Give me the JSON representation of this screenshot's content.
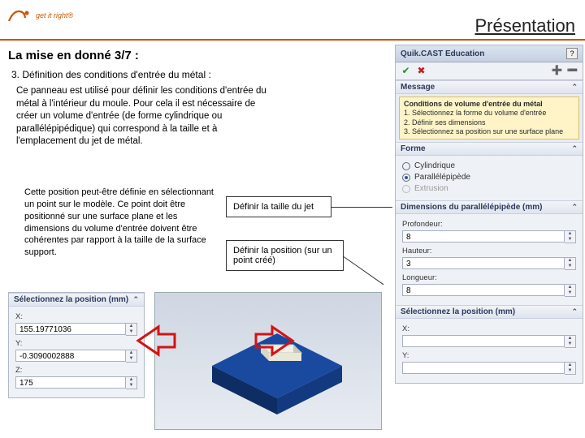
{
  "header": {
    "slogan": "get it right®",
    "title": "Présentation"
  },
  "subtitle": "La mise en donné 3/7 :",
  "sectionHeading": "3. Définition des conditions d'entrée du métal :",
  "paragraph1": "Ce panneau est utilisé pour définir les conditions d'entrée du métal à l'intérieur du moule. Pour cela il est nécessaire de créer un volume d'entrée (de forme cylindrique ou parallélépipédique) qui correspond à la taille et à l'emplacement du jet de métal.",
  "paragraph2": "Cette position peut-être définie en sélectionnant un point sur le modèle. Ce point doit être positionné sur une surface plane et les dimensions du volume d'entrée doivent être cohérentes par rapport à la taille de la surface support.",
  "callout1": "Définir la taille du jet",
  "callout2": "Définir la position (sur un point créé)",
  "rightPanel": {
    "title": "Quik.CAST Education",
    "help": "?",
    "msgHead": "Message",
    "msgTitle": "Conditions de volume d'entrée du métal",
    "msgL1": "1. Sélectionnez la forme du volume d'entrée",
    "msgL2": "2. Définir ses dimensions",
    "msgL3": "3. Sélectionnez sa position sur une surface plane",
    "formeHead": "Forme",
    "opt1": "Cylindrique",
    "opt2": "Parallélépipède",
    "opt3": "Extrusion",
    "dimsHead": "Dimensions du parallélépipède (mm)",
    "profLabel": "Profondeur:",
    "profVal": "8",
    "hautLabel": "Hauteur:",
    "hautVal": "3",
    "longLabel": "Longueur:",
    "longVal": "8",
    "posHead": "Sélectionnez la position (mm)",
    "xLabel": "X:",
    "xVal": "",
    "yLabel": "Y:",
    "yVal": ""
  },
  "leftPanel": {
    "posHead": "Sélectionnez la position (mm)",
    "xLabel": "X:",
    "xVal": "155.19771036",
    "yLabel": "Y:",
    "yVal": "-0.3090002888",
    "zLabel": "Z:",
    "zVal": "175"
  }
}
